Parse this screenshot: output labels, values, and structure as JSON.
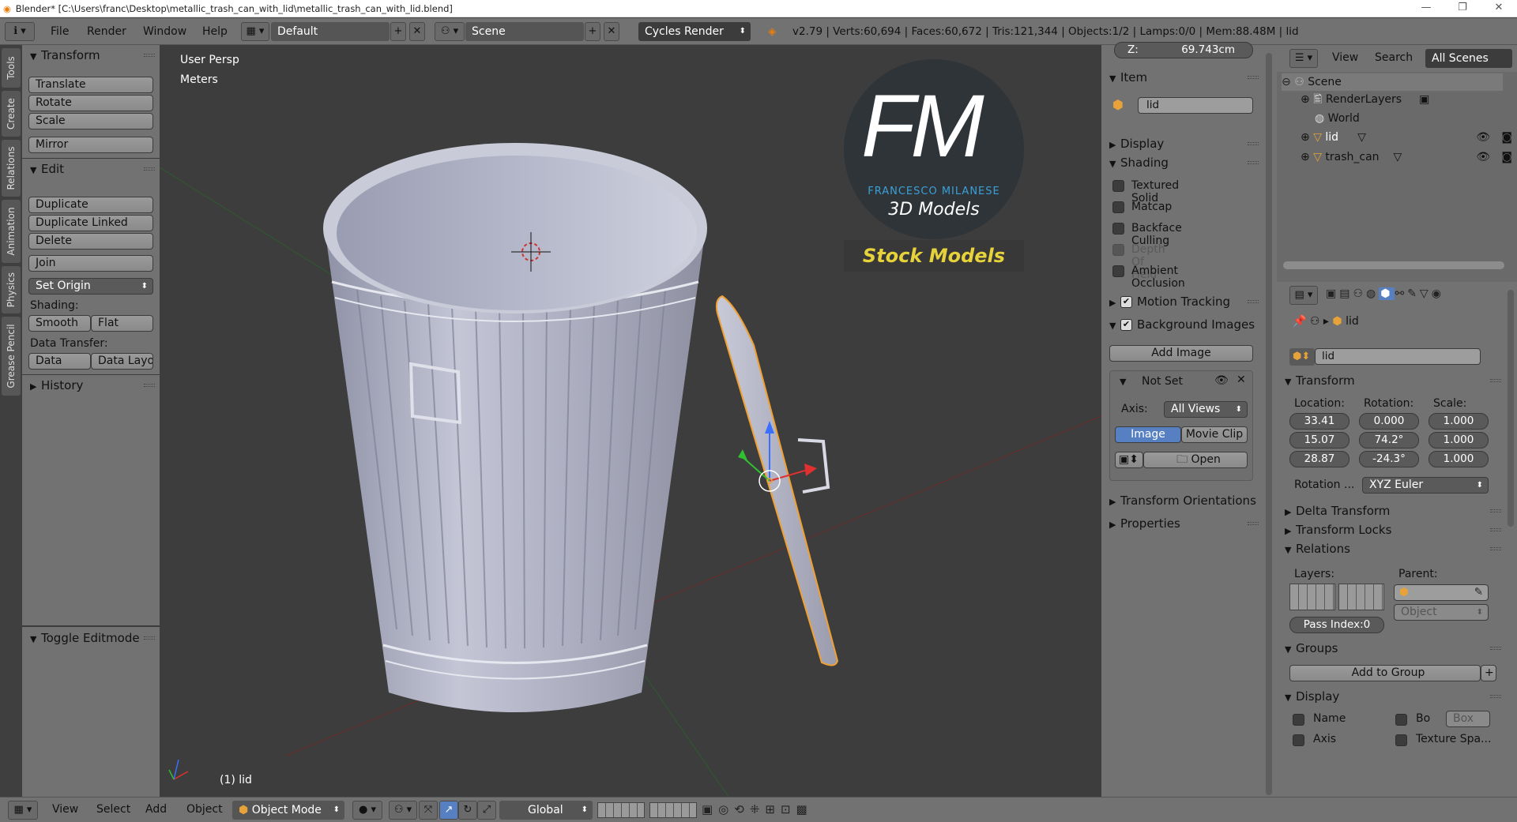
{
  "window": {
    "title": "Blender* [C:\\Users\\franc\\Desktop\\metallic_trash_can_with_lid\\metallic_trash_can_with_lid.blend]",
    "controls": [
      "—",
      "❐",
      "✕"
    ]
  },
  "top_menu": {
    "items": [
      "File",
      "Render",
      "Window",
      "Help"
    ],
    "screen_layout": "Default",
    "scene": "Scene",
    "render_engine": "Cycles Render",
    "stats": "v2.79 | Verts:60,694 | Faces:60,672 | Tris:121,344 | Objects:1/2 | Lamps:0/0 | Mem:88.48M | lid"
  },
  "left_tabs": [
    "Tools",
    "Create",
    "Relations",
    "Animation",
    "Physics",
    "Grease Pencil"
  ],
  "tool_panel": {
    "transform": {
      "header": "Transform",
      "buttons": [
        "Translate",
        "Rotate",
        "Scale"
      ],
      "mirror": "Mirror"
    },
    "edit": {
      "header": "Edit",
      "buttons": [
        "Duplicate",
        "Duplicate Linked",
        "Delete"
      ],
      "join": "Join",
      "set_origin": "Set Origin",
      "shading_label": "Shading:",
      "smooth": "Smooth",
      "flat": "Flat",
      "data_transfer_label": "Data Transfer:",
      "data": "Data",
      "data_layout": "Data Layo"
    },
    "history": "History",
    "toggle_editmode": "Toggle Editmode"
  },
  "viewport": {
    "view_name": "User Persp",
    "units": "Meters",
    "selected_label": "(1) lid",
    "watermark": {
      "letters": "FM",
      "name": "FRANCESCO MILANESE",
      "line2": "3D Models",
      "banner": "Stock Models"
    }
  },
  "npanel": {
    "z_label": "Z:",
    "z_value": "69.743cm",
    "item_header": "Item",
    "item_name": "lid",
    "display_header": "Display",
    "shading_header": "Shading",
    "shading_options": [
      {
        "label": "Textured Solid",
        "checked": false,
        "enabled": true
      },
      {
        "label": "Matcap",
        "checked": false,
        "enabled": true
      },
      {
        "label": "Backface Culling",
        "checked": false,
        "enabled": true
      },
      {
        "label": "Depth Of Field",
        "checked": false,
        "enabled": false
      },
      {
        "label": "Ambient Occlusion",
        "checked": false,
        "enabled": true
      }
    ],
    "motion_tracking": "Motion Tracking",
    "background_images": "Background Images",
    "add_image": "Add Image",
    "not_set": "Not Set",
    "axis_label": "Axis:",
    "axis_value": "All Views",
    "image_tab": "Image",
    "movie_clip_tab": "Movie Clip",
    "open": "Open",
    "transform_orientations": "Transform Orientations",
    "properties": "Properties"
  },
  "outliner": {
    "menu": [
      "View",
      "Search"
    ],
    "filter": "All Scenes",
    "items": [
      {
        "name": "Scene",
        "depth": 0
      },
      {
        "name": "RenderLayers",
        "depth": 1
      },
      {
        "name": "World",
        "depth": 1
      },
      {
        "name": "lid",
        "depth": 1
      },
      {
        "name": "trash_can",
        "depth": 1
      }
    ]
  },
  "properties": {
    "breadcrumb": "lid",
    "object_name": "lid",
    "transform_header": "Transform",
    "location_label": "Location:",
    "rotation_label": "Rotation:",
    "scale_label": "Scale:",
    "location": [
      "33.41",
      "15.07",
      "28.87"
    ],
    "rotation": [
      "0.000",
      "74.2°",
      "-24.3°"
    ],
    "scale": [
      "1.000",
      "1.000",
      "1.000"
    ],
    "rotation_mode_label": "Rotation ...",
    "rotation_mode": "XYZ Euler",
    "delta_transform": "Delta Transform",
    "transform_locks": "Transform Locks",
    "relations": "Relations",
    "layers_label": "Layers:",
    "parent_label": "Parent:",
    "parent_type": "Object",
    "pass_index": "Pass Index:0",
    "groups": "Groups",
    "add_to_group": "Add to Group",
    "display": "Display",
    "name_opt": "Name",
    "bo_opt": "Bo",
    "box_value": "Box",
    "axis_opt": "Axis",
    "texture_space": "Texture Spa..."
  },
  "bottom_bar": {
    "menu": [
      "View",
      "Select",
      "Add",
      "Object"
    ],
    "mode": "Object Mode",
    "orientation": "Global"
  },
  "colors": {
    "accent": "#5680c2",
    "panel": "#727272",
    "viewport": "#3d3d3d",
    "selection_outline": "#f0a030"
  }
}
